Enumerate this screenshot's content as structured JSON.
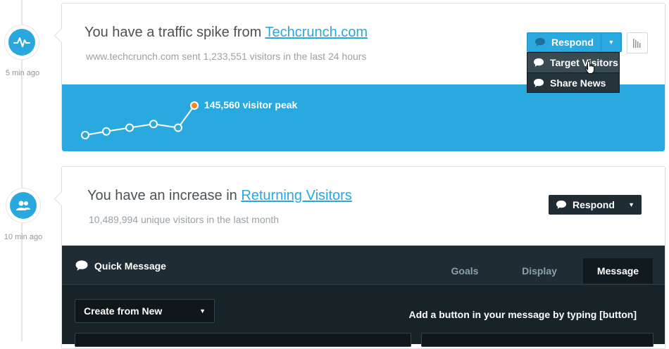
{
  "timeline": [
    {
      "time": "5 min ago",
      "icon": "pulse-icon"
    },
    {
      "time": "10 min ago",
      "icon": "users-icon"
    }
  ],
  "card1": {
    "title_prefix": "You have a traffic spike from ",
    "title_link": "Techcrunch.com",
    "subtitle": "www.techcrunch.com sent 1,233,551 visitors in the last 24 hours",
    "respond_label": "Respond",
    "peak_label": "145,560 visitor peak",
    "menu": [
      {
        "label": "Target Visitors"
      },
      {
        "label": "Share News"
      }
    ],
    "sparkline": [
      1,
      2,
      3,
      4,
      3,
      9
    ],
    "colors": {
      "panel": "#2aa9e0",
      "peak_point": "#f28a1e"
    }
  },
  "card2": {
    "title_prefix": "You have an increase in ",
    "title_link": "Returning Visitors",
    "subtitle": "10,489,994 unique visitors in the last month",
    "respond_label": "Respond",
    "quick_message": {
      "title": "Quick Message",
      "tabs": [
        {
          "label": "Goals",
          "active": false
        },
        {
          "label": "Display",
          "active": false
        },
        {
          "label": "Message",
          "active": true
        }
      ],
      "select_value": "Create from New",
      "hint": "Add a button in your message by typing [button]"
    }
  }
}
